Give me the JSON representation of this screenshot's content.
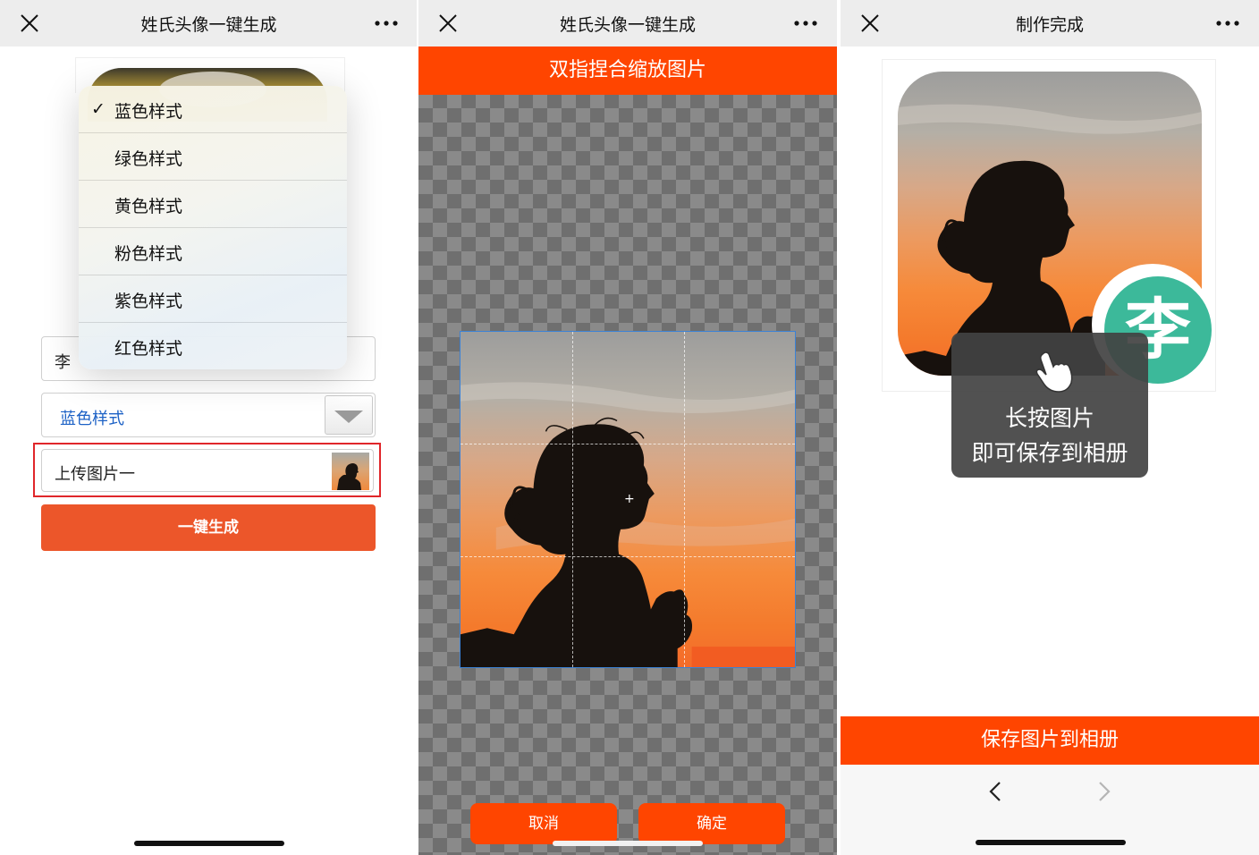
{
  "panel1": {
    "title": "姓氏头像一键生成",
    "dropdown": {
      "options": [
        {
          "label": "蓝色样式",
          "checked": true
        },
        {
          "label": "绿色样式",
          "checked": false
        },
        {
          "label": "黄色样式",
          "checked": false
        },
        {
          "label": "粉色样式",
          "checked": false
        },
        {
          "label": "紫色样式",
          "checked": false
        },
        {
          "label": "红色样式",
          "checked": false
        }
      ],
      "check_mark": "✓"
    },
    "name_value": "李",
    "style_value": "蓝色样式",
    "upload_label": "上传图片一",
    "generate_label": "一键生成"
  },
  "panel2": {
    "title": "姓氏头像一键生成",
    "banner": "双指捏合缩放图片",
    "crosshair": "+",
    "cancel_label": "取消",
    "confirm_label": "确定"
  },
  "panel3": {
    "title": "制作完成",
    "badge_char": "李",
    "tooltip_line1": "长按图片",
    "tooltip_line2": "即可保存到相册",
    "save_label": "保存图片到相册"
  },
  "colors": {
    "accent_orange": "#ff4500",
    "button_orange": "#ec562a",
    "badge_green": "#3cb99a",
    "highlight_red": "#e0262a",
    "link_blue": "#1d62c6"
  },
  "icons": [
    "close-icon",
    "more-icon",
    "chevron-down-icon",
    "check-icon",
    "hand-pointer-icon",
    "back-arrow-icon",
    "forward-arrow-icon"
  ]
}
